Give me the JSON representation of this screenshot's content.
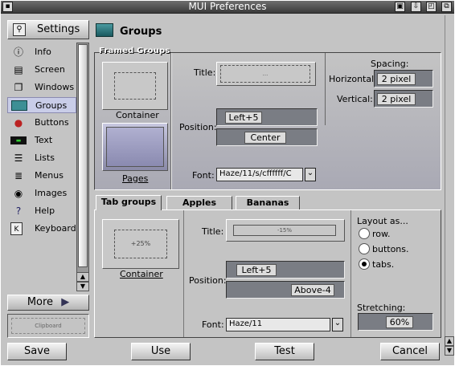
{
  "window": {
    "title": "MUI Preferences",
    "gadgets": [
      "iconify",
      "depth-down",
      "zoom",
      "depth"
    ]
  },
  "sidebar": {
    "settings_label": "Settings",
    "items": [
      {
        "label": "Info",
        "icon": "info-icon"
      },
      {
        "label": "Screen",
        "icon": "screen-icon"
      },
      {
        "label": "Windows",
        "icon": "windows-icon"
      },
      {
        "label": "Groups",
        "icon": "groups-icon",
        "selected": true
      },
      {
        "label": "Buttons",
        "icon": "buttons-icon"
      },
      {
        "label": "Text",
        "icon": "text-icon"
      },
      {
        "label": "Lists",
        "icon": "lists-icon"
      },
      {
        "label": "Menus",
        "icon": "menus-icon"
      },
      {
        "label": "Images",
        "icon": "images-icon"
      },
      {
        "label": "Help",
        "icon": "help-icon"
      },
      {
        "label": "Keyboard",
        "icon": "keyboard-icon"
      }
    ],
    "more_label": "More",
    "clipboard_label": "Clipboard"
  },
  "header": {
    "title": "Groups"
  },
  "framed": {
    "title": "Framed Groups",
    "container_label": "Container",
    "pages_label": "Pages",
    "title_label": "Title:",
    "title_preview": "...",
    "position_label": "Position:",
    "position_value": "Left+5",
    "center_value": "Center",
    "font_label": "Font:",
    "font_value": "Haze/11/s/cffffff/C",
    "spacing_label": "Spacing:",
    "horizontal_label": "Horizontal:",
    "horizontal_value": "2 pixel",
    "vertical_label": "Vertical:",
    "vertical_value": "2 pixel"
  },
  "tabs": [
    {
      "label": "Tab groups",
      "active": true
    },
    {
      "label": "Apples",
      "active": false
    },
    {
      "label": "Bananas",
      "active": false
    }
  ],
  "tabgroups": {
    "container_preview": "+25%",
    "container_label": "Container",
    "title_label": "Title:",
    "title_preview": "-15%",
    "position_label": "Position:",
    "position_value1": "Left+5",
    "position_value2": "Above-4",
    "font_label": "Font:",
    "font_value": "Haze/11",
    "layout_label": "Layout as...",
    "layout_options": [
      "row.",
      "buttons.",
      "tabs."
    ],
    "layout_selected": 2,
    "stretching_label": "Stretching:",
    "stretching_value": "60%"
  },
  "buttons": {
    "save": "Save",
    "use": "Use",
    "test": "Test",
    "cancel": "Cancel"
  }
}
